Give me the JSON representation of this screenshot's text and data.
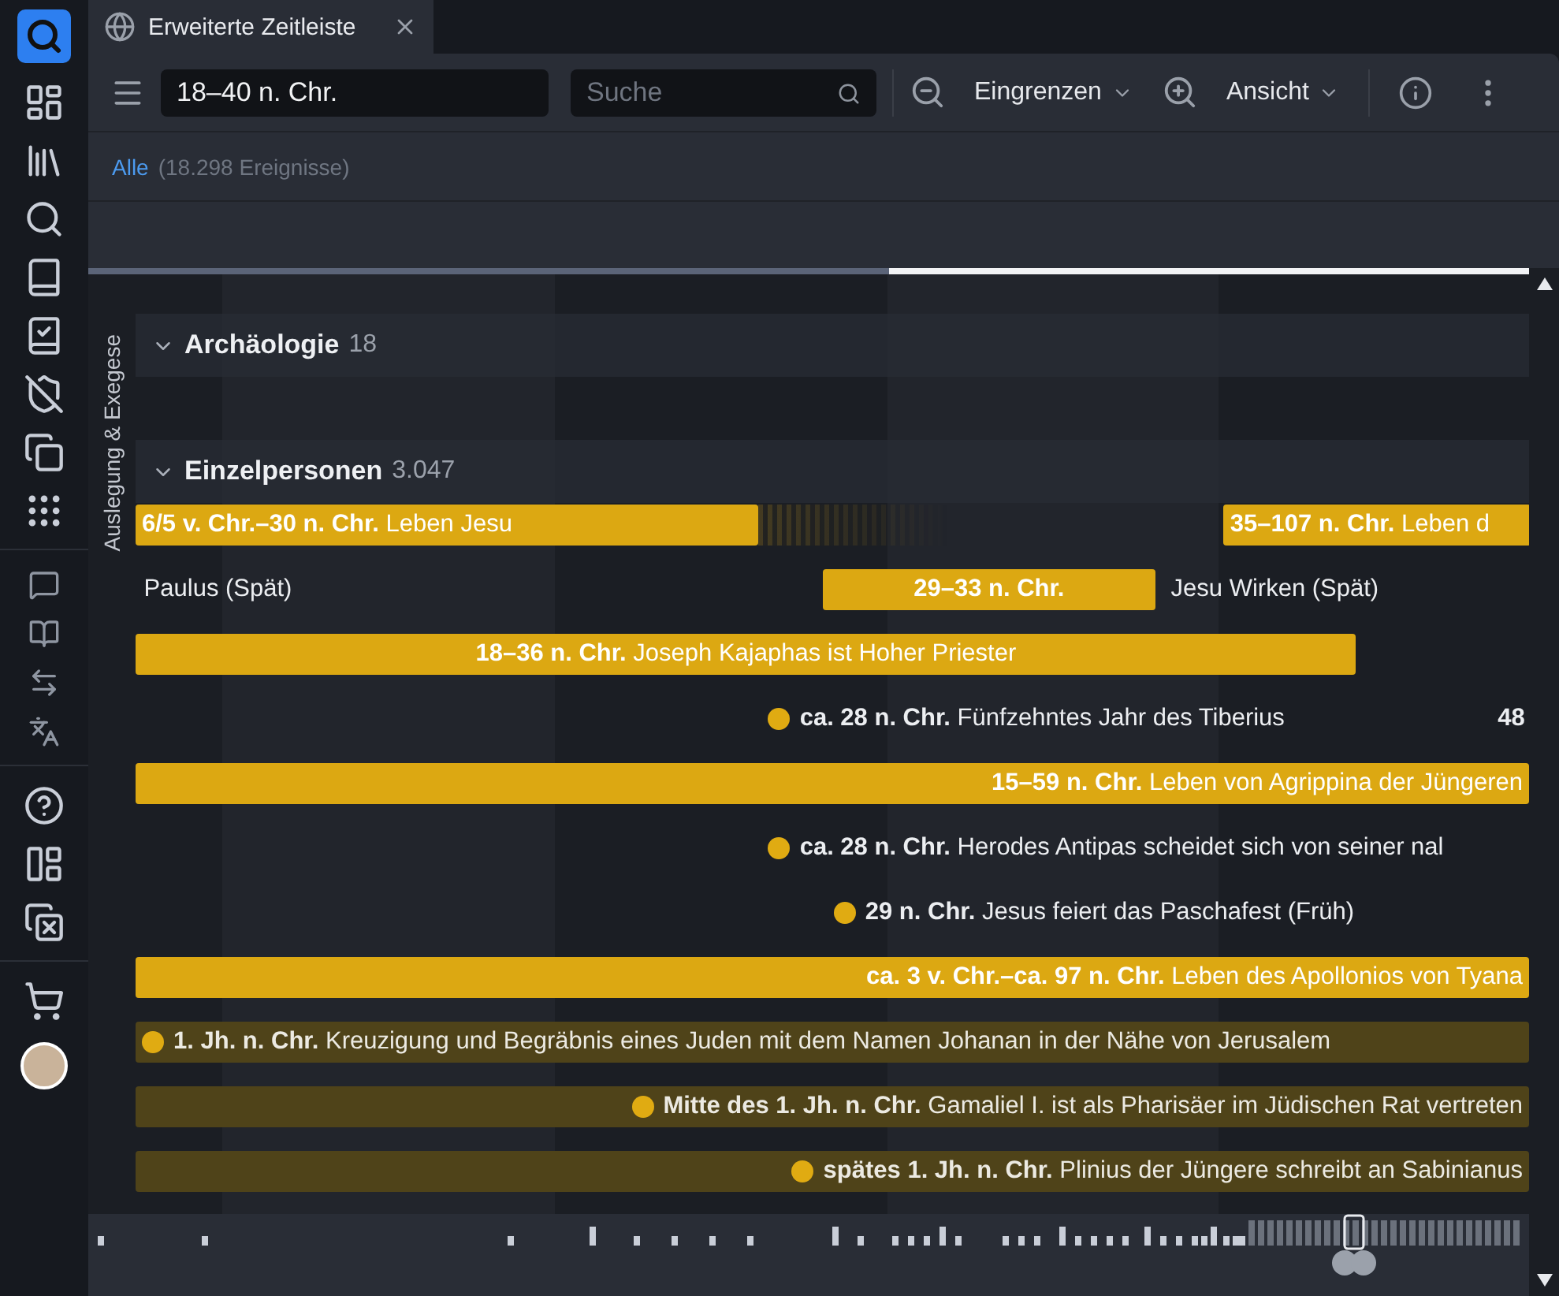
{
  "sidebar": {
    "items": [
      {
        "kind": "logo"
      },
      {
        "kind": "dashboard"
      },
      {
        "kind": "library"
      },
      {
        "kind": "search"
      },
      {
        "kind": "bible"
      },
      {
        "kind": "plan"
      },
      {
        "kind": "shield"
      },
      {
        "kind": "copies"
      },
      {
        "kind": "apps"
      },
      {
        "kind": "divider"
      },
      {
        "kind": "chat"
      },
      {
        "kind": "book"
      },
      {
        "kind": "swap"
      },
      {
        "kind": "translate"
      },
      {
        "kind": "divider"
      },
      {
        "kind": "help"
      },
      {
        "kind": "layout"
      },
      {
        "kind": "close_all"
      },
      {
        "kind": "divider"
      },
      {
        "kind": "cart"
      },
      {
        "kind": "avatar"
      }
    ]
  },
  "tab": {
    "title": "Erweiterte Zeitleiste"
  },
  "toolbar": {
    "range": "18–40 n. Chr.",
    "search": {
      "placeholder": "Suche"
    },
    "filter": "Eingrenzen",
    "view": "Ansicht"
  },
  "filter_row": {
    "link": "Alle",
    "count": "(18.298 Ereignisse)"
  },
  "section": "Auslegung & Exegese",
  "groups": [
    {
      "title": "Archäologie",
      "count": "18",
      "expanded": true
    },
    {
      "title": "Einzelpersonen",
      "count": "3.047",
      "expanded": true,
      "lanes": [
        {
          "events": [
            {
              "kind": "bar",
              "date": "6/5 v. Chr.–30 n. Chr.",
              "title": "Leben Jesu"
            },
            {
              "kind": "fade"
            },
            {
              "kind": "bar",
              "date": "35–107 n. Chr.",
              "title": "Leben d"
            }
          ]
        },
        {
          "events": [
            {
              "kind": "label",
              "title": "Paulus (Spät)"
            },
            {
              "kind": "bar",
              "date": "29–33 n. Chr."
            },
            {
              "kind": "label",
              "title": "Jesu Wirken (Spät)"
            }
          ]
        },
        {
          "events": [
            {
              "kind": "bar",
              "date": "18–36 n. Chr.",
              "title": "Joseph Kajaphas ist Hoher Priester"
            }
          ]
        },
        {
          "events": [
            {
              "kind": "point",
              "date": "ca. 28 n. Chr.",
              "title": "Fünfzehntes Jahr des Tiberius"
            },
            {
              "kind": "count",
              "title": "48"
            }
          ]
        },
        {
          "events": [
            {
              "kind": "bar",
              "date": "15–59 n. Chr.",
              "title": "Leben von Agrippina der Jüngeren"
            }
          ]
        },
        {
          "events": [
            {
              "kind": "point",
              "date": "ca. 28 n. Chr.",
              "title": "Herodes Antipas scheidet sich von seiner nal"
            }
          ]
        },
        {
          "events": [
            {
              "kind": "point",
              "date": "29 n. Chr.",
              "title": "Jesus feiert das Paschafest (Früh)"
            }
          ]
        },
        {
          "events": [
            {
              "kind": "bar",
              "date": "ca. 3 v. Chr.–ca. 97 n. Chr.",
              "title": "Leben des Apollonios von Tyana"
            }
          ]
        },
        {
          "events": [
            {
              "kind": "soft_bar",
              "date": "1. Jh. n. Chr.",
              "title": "Kreuzigung und Begräbnis eines Juden mit dem Namen Johanan in der Nähe von Jerusalem"
            }
          ]
        },
        {
          "events": [
            {
              "kind": "soft_bar",
              "date": "Mitte des 1. Jh. n. Chr.",
              "title": "Gamaliel I. ist als Pharisäer im Jüdischen Rat vertreten"
            }
          ]
        },
        {
          "events": [
            {
              "kind": "soft_bar",
              "date": "spätes 1. Jh. n. Chr.",
              "title": "Plinius der Jüngere schreibt an Sabinianus"
            }
          ]
        }
      ]
    }
  ]
}
